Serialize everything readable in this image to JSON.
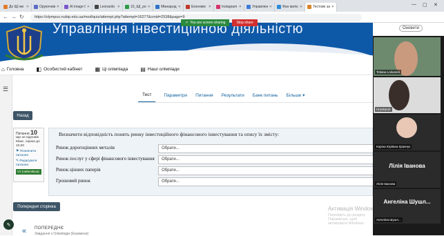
{
  "browser": {
    "tabs": [
      {
        "label": "До ЩІ мо",
        "color": "#e07b2a"
      },
      {
        "label": "Орукочнів",
        "color": "#5a6cc4"
      },
      {
        "label": "AI image G",
        "color": "#7a56c9"
      },
      {
        "label": "Leonardo",
        "color": "#444444"
      },
      {
        "label": "10_ЩІ_ро",
        "color": "#2c9c47"
      },
      {
        "label": "Міжнарод",
        "color": "#2f72c8"
      },
      {
        "label": "Економік",
        "color": "#c0392b"
      },
      {
        "label": "Instagram",
        "color": "#d6336c"
      },
      {
        "label": "Управлінн",
        "color": "#3d7bd9"
      },
      {
        "label": "Фан матіє",
        "color": "#2c8ad6"
      },
      {
        "label": "Тестове за",
        "color": "#d9822b"
      }
    ],
    "url": "https://olympus.nubip.edu.ua/mod/quiz/attempt.php?attempt=16277&cmid=2538&page=9",
    "update_label": "Оновити",
    "share_text": "You are screen sharing",
    "stop_share": "Stop share"
  },
  "site": {
    "banner_title": "Управління інвестиційною діяльністю",
    "menu": [
      {
        "label": "Головна",
        "icon": "home-icon"
      },
      {
        "label": "Особистий кабінет",
        "icon": "dashboard-icon"
      },
      {
        "label": "Ці олімпіада",
        "icon": "course-icon"
      },
      {
        "label": "Наші олімпіади",
        "icon": "courses-icon"
      }
    ]
  },
  "quiz": {
    "subnav": [
      "Тест",
      "Параметри",
      "Питання",
      "Результати",
      "Банк питань",
      "Більше ▾"
    ],
    "back_label": "Назад",
    "question_info": {
      "label": "Питання",
      "number": "10",
      "status": "Ще не відповів",
      "mark": "Макс. оцінка до 10,00",
      "flag": "Позначити питання",
      "edit": "Редагувати питання",
      "version": "V2 (найновіша)"
    },
    "question_text": "Визначити відповідність понять ринку інвестиційного фінансового інвестування та опису їх змісту:",
    "rows": [
      {
        "term": "Ринок дорогоцінних металів",
        "choice": "Обрати..."
      },
      {
        "term": "Ринок послуг у сфері фінансового інвестування",
        "choice": "Обрати..."
      },
      {
        "term": "Ринок цінних паперів",
        "choice": "Обрати..."
      },
      {
        "term": "Грошовий ринок",
        "choice": "Обрати..."
      }
    ],
    "prev_page": "Попередня сторінка",
    "prev_activity_label": "ПОПЕРЕДНЄ",
    "prev_activity_sub": "Завдання з Олімпіади (Екзамени)"
  },
  "windows_watermark": {
    "title": "Активація Windows",
    "text": "Перейдіть до розділу Параметри, щоб активувати Windows."
  },
  "participants": [
    {
      "name": "Tetiana Lokuneni"
    },
    {
      "name": "Hrynkaruk"
    },
    {
      "name": "Каріна Юріївна Кравчук"
    },
    {
      "name": "Лілія Іванова",
      "display": "Лілія Іванова"
    },
    {
      "name": "Ангеліна Шушл...",
      "display": "Ангеліна Шушл..."
    }
  ]
}
